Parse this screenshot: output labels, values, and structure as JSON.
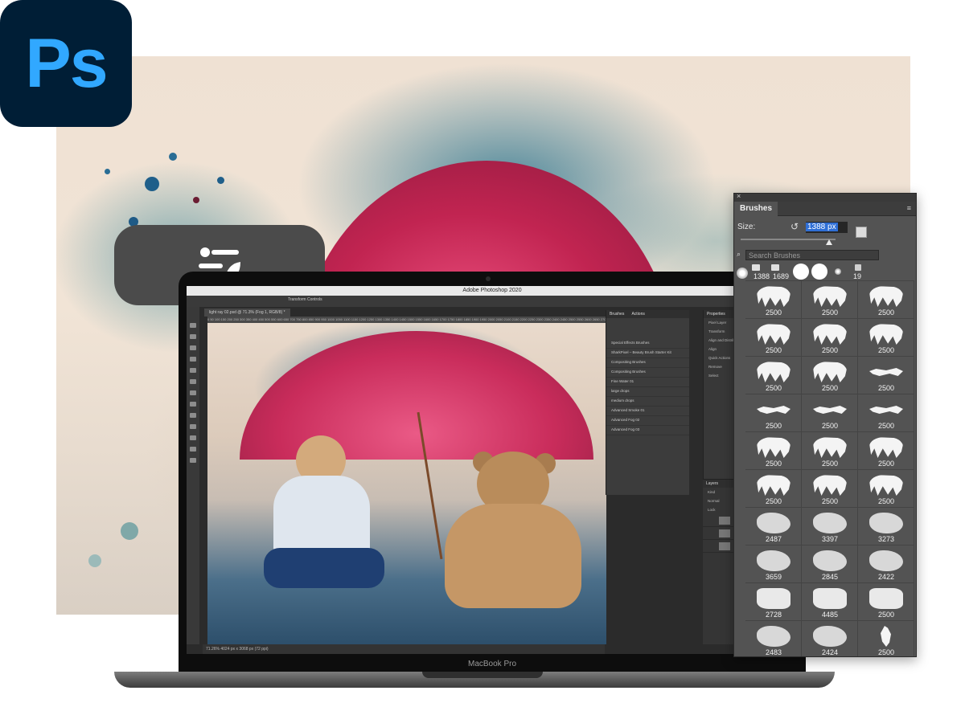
{
  "app_icon": {
    "label": "Ps",
    "bg_color": "#001e36",
    "text_color": "#31a8ff"
  },
  "laptop": {
    "window_title": "Adobe Photoshop 2020",
    "brand": "MacBook Pro",
    "doc_tab": "light ray 02.psd @ 71.3% (Fog 1, RGB/8) *",
    "options_text": "Transform Controls",
    "ruler_marks": "0 50 100 150 200 250 300 350 400 450 500 550 600 650 700 750 800 850 900 950 1000 1050 1100 1150 1200 1250 1300 1350 1400 1450 1500 1550 1600 1650 1700 1750 1800 1850 1900 1950 2000 2050 2100 2150 2200 2250 2300 2350 2400 2450 2500 2550 2600 2650 2700 2750 2800 2850 2900 2950 3000 3050 3100 3150 3200",
    "status": "71.26%     4024 px x 3068 px (72 ppi)",
    "mini_panel": {
      "tabs": [
        "Brushes",
        "Actions"
      ],
      "rows": [
        "Special Effects Brushes",
        "SharkPixel – Beauty Brush Starter Kit",
        "Compositing Brushes",
        "Compositing Brushes",
        "Fine Water 01",
        "large drops",
        "medium drops",
        "Advanced Smoke 01",
        "Advanced Fog 02",
        "Advanced Fog 03"
      ]
    },
    "right_panel": {
      "tabs": [
        "Properties",
        "Adjustments"
      ],
      "labels": [
        "Pixel Layer",
        "Transform",
        "Align and Distribute",
        "Align",
        "Quick Actions",
        "Remove",
        "Select"
      ],
      "layers_tabs": [
        "Layers",
        "Channels"
      ],
      "layers_labels": [
        "Kind",
        "Normal",
        "Lock"
      ]
    }
  },
  "brushes_panel": {
    "tab": "Brushes",
    "close": "×",
    "menu_icon": "≡",
    "size_label": "Size:",
    "size_value": "1388 px",
    "search_placeholder": "Search Brushes",
    "recent": [
      "1388",
      "1689",
      "19"
    ],
    "cells": [
      {
        "value": "2500",
        "shape": "drip"
      },
      {
        "value": "2500",
        "shape": "drip"
      },
      {
        "value": "2500",
        "shape": "drip"
      },
      {
        "value": "2500",
        "shape": "drip"
      },
      {
        "value": "2500",
        "shape": "drip"
      },
      {
        "value": "2500",
        "shape": "drip"
      },
      {
        "value": "2500",
        "shape": "drip"
      },
      {
        "value": "2500",
        "shape": "drip"
      },
      {
        "value": "2500",
        "shape": "line"
      },
      {
        "value": "2500",
        "shape": "line"
      },
      {
        "value": "2500",
        "shape": "line"
      },
      {
        "value": "2500",
        "shape": "line"
      },
      {
        "value": "2500",
        "shape": "drip"
      },
      {
        "value": "2500",
        "shape": "drip"
      },
      {
        "value": "2500",
        "shape": "drip"
      },
      {
        "value": "2500",
        "shape": "drip"
      },
      {
        "value": "2500",
        "shape": "drip"
      },
      {
        "value": "2500",
        "shape": "drip"
      },
      {
        "value": "2487",
        "shape": "cloud"
      },
      {
        "value": "3397",
        "shape": "cloud"
      },
      {
        "value": "3273",
        "shape": "cloud"
      },
      {
        "value": "3659",
        "shape": "cloud"
      },
      {
        "value": "2845",
        "shape": "cloud"
      },
      {
        "value": "2422",
        "shape": "cloud"
      },
      {
        "value": "2728",
        "shape": "blot"
      },
      {
        "value": "4485",
        "shape": "blot"
      },
      {
        "value": "2500",
        "shape": "blot"
      },
      {
        "value": "2483",
        "shape": "cloud"
      },
      {
        "value": "2424",
        "shape": "cloud"
      },
      {
        "value": "2500",
        "shape": "spray"
      }
    ]
  }
}
